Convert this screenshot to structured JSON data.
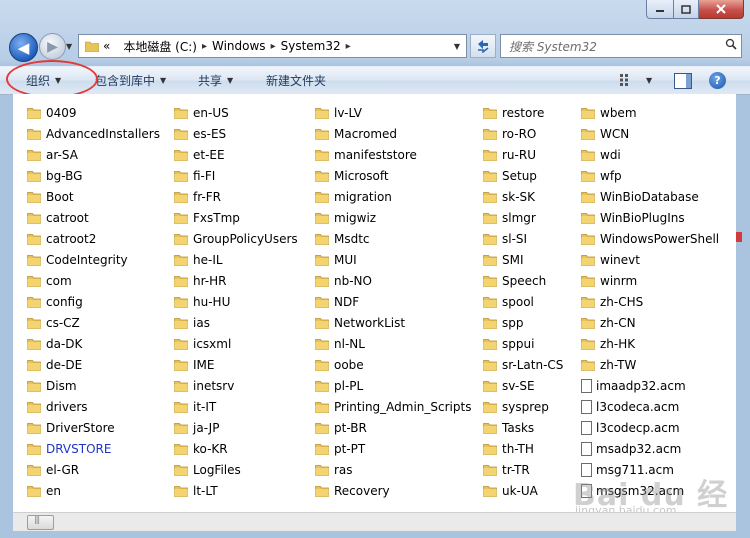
{
  "nav": {
    "back_glyph": "◀",
    "forward_glyph": "▶",
    "history_glyph": "▼"
  },
  "address": {
    "overflow": "«",
    "segments": [
      "本地磁盘 (C:)",
      "Windows",
      "System32"
    ],
    "sep_glyph": "▸",
    "drop_glyph": "▼"
  },
  "search": {
    "placeholder": "搜索 System32"
  },
  "commands": {
    "organize": "组织",
    "include_in_library": "包含到库中",
    "share": "共享",
    "new_folder": "新建文件夹",
    "dropdown_glyph": "▼",
    "help_glyph": "?"
  },
  "columns": [
    [
      "0409",
      "AdvancedInstallers",
      "ar-SA",
      "bg-BG",
      "Boot",
      "catroot",
      "catroot2",
      "CodeIntegrity",
      "com",
      "config",
      "cs-CZ",
      "da-DK",
      "de-DE",
      "Dism",
      "drivers",
      "DriverStore",
      "DRVSTORE",
      "el-GR",
      "en"
    ],
    [
      "en-US",
      "es-ES",
      "et-EE",
      "fi-FI",
      "fr-FR",
      "FxsTmp",
      "GroupPolicyUsers",
      "he-IL",
      "hr-HR",
      "hu-HU",
      "ias",
      "icsxml",
      "IME",
      "inetsrv",
      "it-IT",
      "ja-JP",
      "ko-KR",
      "LogFiles",
      "lt-LT"
    ],
    [
      "lv-LV",
      "Macromed",
      "manifeststore",
      "Microsoft",
      "migration",
      "migwiz",
      "Msdtc",
      "MUI",
      "nb-NO",
      "NDF",
      "NetworkList",
      "nl-NL",
      "oobe",
      "pl-PL",
      "Printing_Admin_Scripts",
      "pt-BR",
      "pt-PT",
      "ras",
      "Recovery"
    ],
    [
      "restore",
      "ro-RO",
      "ru-RU",
      "Setup",
      "sk-SK",
      "slmgr",
      "sl-SI",
      "SMI",
      "Speech",
      "spool",
      "spp",
      "sppui",
      "sr-Latn-CS",
      "sv-SE",
      "sysprep",
      "Tasks",
      "th-TH",
      "tr-TR",
      "uk-UA"
    ],
    [
      "wbem",
      "WCN",
      "wdi",
      "wfp",
      "WinBioDatabase",
      "WinBioPlugIns",
      "WindowsPowerShell",
      "winevt",
      "winrm",
      "zh-CHS",
      "zh-CN",
      "zh-HK",
      "zh-TW",
      "imaadp32.acm",
      "l3codeca.acm",
      "l3codecp.acm",
      "msadp32.acm",
      "msg711.acm",
      "msgsm32.acm"
    ]
  ],
  "highlighted_item": "DRVSTORE",
  "watermark": {
    "text": "Bai du 经验",
    "url": "jingyan.baidu.com"
  },
  "colors": {
    "highlight_link": "#1f36c4",
    "annotation_circle": "#e23a3a",
    "folder": "#e8c35a"
  }
}
